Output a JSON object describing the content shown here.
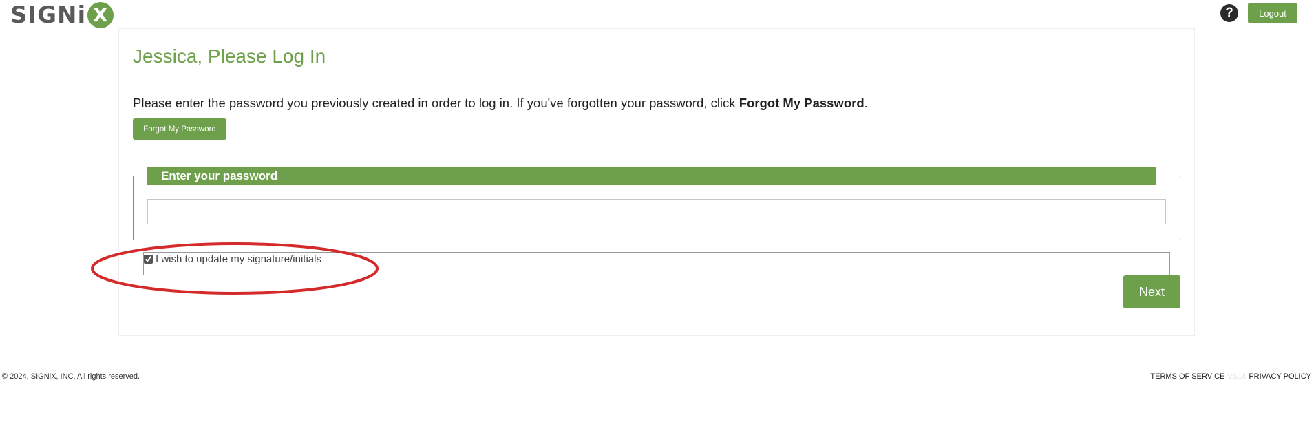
{
  "header": {
    "logo_text": "SIGNi",
    "logo_x": "X",
    "help_icon": "?",
    "logout_label": "Logout"
  },
  "main": {
    "title": "Jessica, Please Log In",
    "instructions_prefix": "Please enter the password you previously created in order to log in. If you've forgotten your password, click ",
    "instructions_bold": "Forgot My Password",
    "instructions_suffix": ".",
    "forgot_button": "Forgot My Password",
    "password_legend": "Enter your password",
    "password_value": "",
    "signature_checkbox_label": "I wish to update my signature/initials",
    "signature_checked": true,
    "next_button": "Next"
  },
  "annotation": {
    "color": "#d42a2a",
    "shape": "ellipse"
  },
  "footer": {
    "copyright": "© 2024, SIGNiX, INC. All rights reserved.",
    "terms": "TERMS OF SERVICE",
    "version": "VS14",
    "privacy": "PRIVACY POLICY"
  },
  "colors": {
    "brand_green": "#6ea04b",
    "logo_gray": "#5a5a5a"
  }
}
